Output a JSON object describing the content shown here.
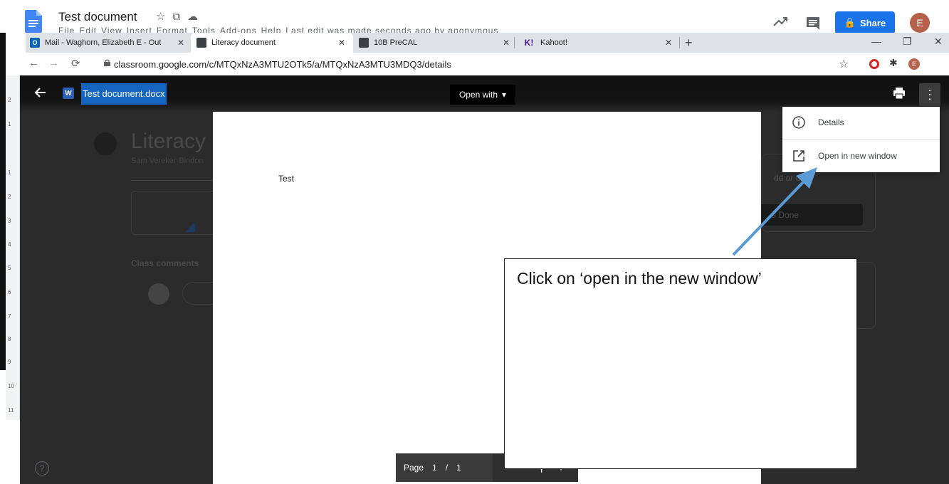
{
  "docs": {
    "title": "Test document",
    "menu": [
      "File",
      "Edit",
      "View",
      "Insert",
      "Format",
      "Tools",
      "Add-ons",
      "Help"
    ],
    "last_edit": "Last edit was made seconds ago by anonymous",
    "share_label": "Share",
    "avatar_letter": "E",
    "share_color": "#1a73e8"
  },
  "browser": {
    "tabs": [
      {
        "label": "Mail - Waghorn, Elizabeth E - Out",
        "icon": "outlook-icon",
        "active": false
      },
      {
        "label": "Literacy document",
        "icon": "classroom-icon",
        "active": true
      },
      {
        "label": "10B PreCAL",
        "icon": "classroom-icon",
        "active": false
      },
      {
        "label": "Kahoot!",
        "icon": "kahoot-icon",
        "active": false
      }
    ],
    "url": "classroom.google.com/c/MTQxNzA3MTU2OTk5/a/MTQxNzA3MTU3MDQ3/details",
    "profile_letter": "E"
  },
  "ruler": {
    "numbers": [
      "2",
      "1",
      "1",
      "2",
      "3",
      "4",
      "5",
      "6",
      "7",
      "8",
      "9",
      "10",
      "11"
    ]
  },
  "background": {
    "title": "Literacy",
    "subtitle": "Sam Vereker-Bindon",
    "comments": "Class comments",
    "add_or_create": "dd or c",
    "mark_done": "s Done"
  },
  "viewer": {
    "file_name": "Test document.docx",
    "word_badge": "W",
    "open_with": "Open with",
    "doc_text": "Test",
    "pager": {
      "label": "Page",
      "current": "1",
      "sep": "/",
      "total": "1"
    },
    "help": "?"
  },
  "menu": {
    "items": [
      {
        "label": "Details",
        "icon": "info-icon"
      },
      {
        "label": "Open in new window",
        "icon": "open-new-window-icon"
      }
    ]
  },
  "callout": {
    "text": "Click on ‘open in the new window’",
    "arrow_color": "#5b9bd5"
  }
}
